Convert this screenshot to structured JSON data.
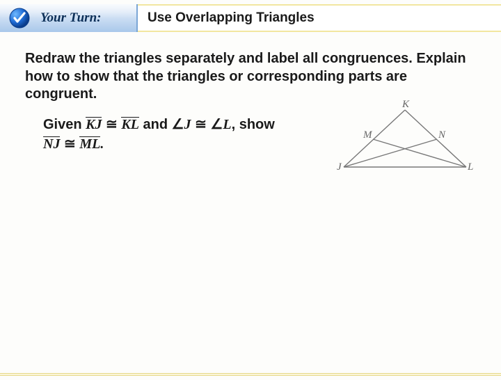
{
  "header": {
    "your_turn": "Your Turn:",
    "title": "Use Overlapping Triangles"
  },
  "instruction": "Redraw the triangles separately and label all congruences. Explain how to show that the triangles or corresponding parts are congruent.",
  "given": {
    "word_given": "Given",
    "seg1": "KJ",
    "cong": "≅",
    "seg2": "KL",
    "and": " and ",
    "ang": "∠",
    "J": "J",
    "L": "L",
    "show": ", show",
    "seg3": "NJ",
    "seg4": "ML",
    "period": "."
  },
  "figure": {
    "K": "K",
    "M": "M",
    "N": "N",
    "J": "J",
    "L": "L"
  }
}
